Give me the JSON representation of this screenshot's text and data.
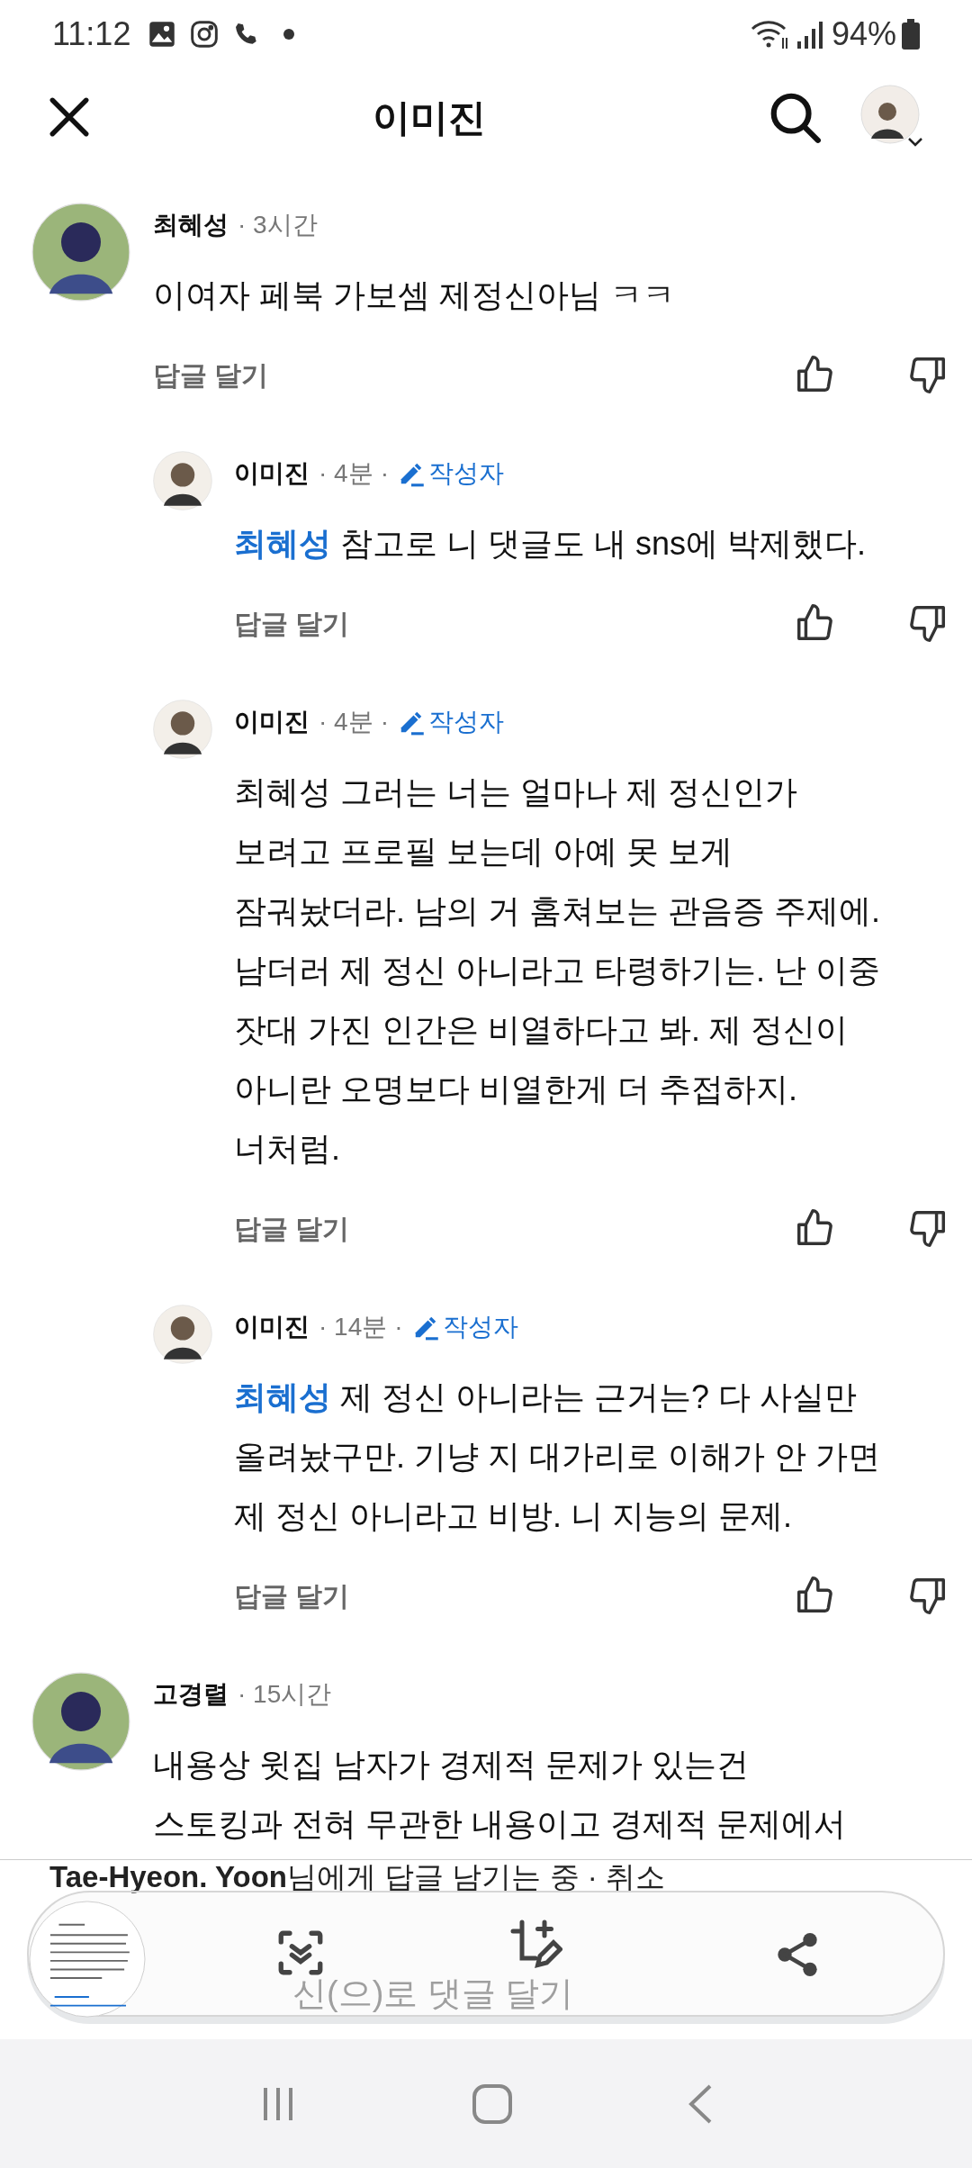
{
  "status_bar": {
    "time": "11:12",
    "battery": "94%"
  },
  "header": {
    "title": "이미진"
  },
  "comments": [
    {
      "author": "최혜성",
      "time": "· 3시간",
      "lines": [
        "이여자 페북 가보셈 제정신아님 ㅋㅋ"
      ],
      "reply_label": "답글 달기",
      "children": [
        {
          "author": "이미진",
          "time": "· 4분",
          "separator": "·",
          "badge": "작성자",
          "mention": "최혜성",
          "lines": [
            "참고로 니 댓글도 내 sns에 박제했다."
          ],
          "reply_label": "답글 달기"
        },
        {
          "author": "이미진",
          "time": "· 4분",
          "separator": "·",
          "badge": "작성자",
          "lines": [
            "최혜성 그러는 너는 얼마나 제 정신인가",
            "보려고 프로필 보는데 아예 못 보게",
            "잠궈놨더라. 남의 거 훔쳐보는 관음증 주제에.",
            "남더러 제 정신 아니라고 타령하기는. 난 이중",
            "잣대 가진 인간은 비열하다고 봐. 제 정신이",
            "아니란 오명보다 비열한게 더 추접하지.",
            "너처럼."
          ],
          "reply_label": "답글 달기"
        },
        {
          "author": "이미진",
          "time": "· 14분",
          "separator": "·",
          "badge": "작성자",
          "mention": "최혜성",
          "lines": [
            "제 정신 아니라는 근거는? 다 사실만",
            "올려놨구만. 기냥 지 대가리로 이해가 안 가면",
            "제 정신 아니라고 비방. 니 지능의 문제."
          ],
          "reply_label": "답글 달기"
        }
      ]
    },
    {
      "author": "고경렬",
      "time": "· 15시간",
      "lines": [
        "내용상 윗집 남자가 경제적 문제가 있는건",
        "스토킹과 전혀 무관한 내용이고 경제적 문제에서"
      ]
    }
  ],
  "reply_bar": {
    "target": "Tae-Hyeon. Yoon",
    "status": "님에게 답글 남기는 중 · 취소",
    "placeholder": "신(으)로 댓글 달기"
  }
}
